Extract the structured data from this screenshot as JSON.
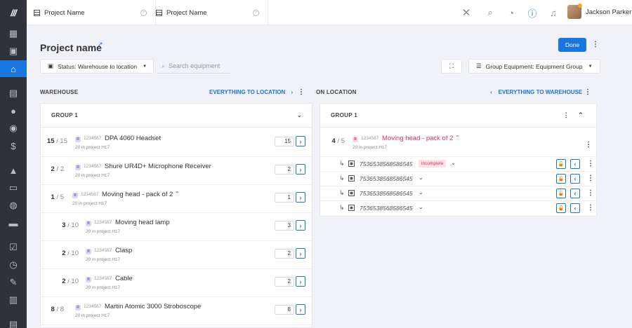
{
  "app": {
    "logo": "///"
  },
  "tabs": [
    {
      "label": "Project Name"
    },
    {
      "label": "Project Name"
    }
  ],
  "topbar": {
    "user": "Jackson Parker"
  },
  "page": {
    "title": "Project name",
    "done": "Done"
  },
  "filters": {
    "status": "Status: Warehouse to location",
    "search_placeholder": "Search equipment",
    "group": "Group Equipment: Equipment Group"
  },
  "warehouse": {
    "label": "WAREHOUSE",
    "link": "EVERYTHING TO LOCATION",
    "group": "GROUP 1",
    "items": [
      {
        "qty": "15",
        "total": "/ 15",
        "code": "1234567",
        "name": "DPA 4060 Headset",
        "sub": "20  in project   H17",
        "box": "15"
      },
      {
        "qty": "2",
        "total": "/ 2",
        "code": "1234567",
        "name": "Shure UR4D+ Microphone Receiver",
        "sub": "20  in project   H17",
        "box": "2"
      },
      {
        "qty": "1",
        "total": "/ 5",
        "code": "1234567",
        "name": "Moving head - pack of 2",
        "sub": "20  in project   H17",
        "box": "1"
      },
      {
        "qty": "3",
        "total": "/ 10",
        "code": "1234567",
        "name": "Moving head lamp",
        "sub": "20  in project   H17",
        "box": "3"
      },
      {
        "qty": "2",
        "total": "/ 10",
        "code": "1234567",
        "name": "Clasp",
        "sub": "20  in project   H17",
        "box": "2"
      },
      {
        "qty": "2",
        "total": "/ 10",
        "code": "1234567",
        "name": "Cable",
        "sub": "20  in project   H17",
        "box": "2"
      },
      {
        "qty": "8",
        "total": "/ 8",
        "code": "1234567",
        "name": "Martin Atomic 3000 Stroboscope",
        "sub": "20  in project   H17",
        "box": "8"
      }
    ]
  },
  "location": {
    "label": "ON LOCATION",
    "link": "EVERYTHING TO WAREHOUSE",
    "group": "GROUP 1",
    "item": {
      "qty": "4",
      "total": "/ 5",
      "code": "1234567",
      "name": "Moving head - pack of 2",
      "sub": "20  in project   H17"
    },
    "units": [
      {
        "serial": "7536538568586545",
        "status": "incomplete"
      },
      {
        "serial": "7536538568586545",
        "status": ""
      },
      {
        "serial": "7536538568586545",
        "status": ""
      },
      {
        "serial": "7536538568586545",
        "status": ""
      }
    ]
  }
}
